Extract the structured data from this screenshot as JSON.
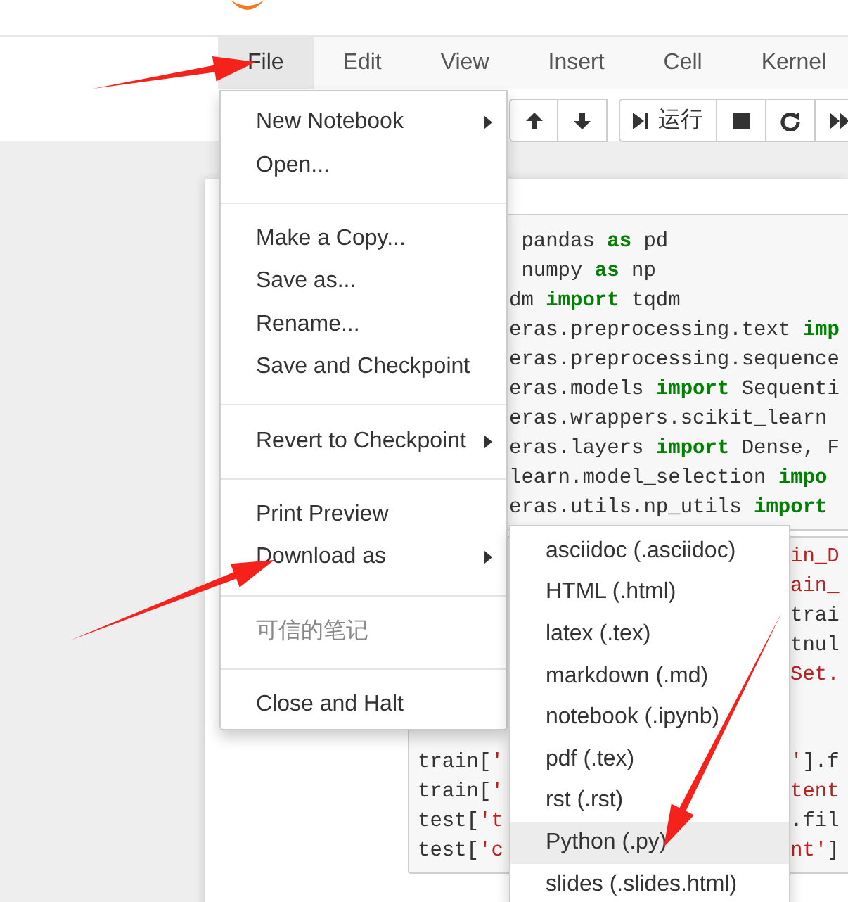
{
  "menubar": [
    {
      "label": "File",
      "selected": true
    },
    {
      "label": "Edit",
      "selected": false
    },
    {
      "label": "View",
      "selected": false
    },
    {
      "label": "Insert",
      "selected": false
    },
    {
      "label": "Cell",
      "selected": false
    },
    {
      "label": "Kernel",
      "selected": false
    }
  ],
  "toolbar": {
    "run_label": "运行"
  },
  "file_menu": [
    {
      "kind": "item",
      "label": "New Notebook",
      "submenu": true,
      "disabled": false
    },
    {
      "kind": "item",
      "label": "Open...",
      "submenu": false,
      "disabled": false
    },
    {
      "kind": "divider"
    },
    {
      "kind": "item",
      "label": "Make a Copy...",
      "submenu": false,
      "disabled": false
    },
    {
      "kind": "item",
      "label": "Save as...",
      "submenu": false,
      "disabled": false
    },
    {
      "kind": "item",
      "label": "Rename...",
      "submenu": false,
      "disabled": false
    },
    {
      "kind": "item",
      "label": "Save and Checkpoint",
      "submenu": false,
      "disabled": false
    },
    {
      "kind": "divider"
    },
    {
      "kind": "item",
      "label": "Revert to Checkpoint",
      "submenu": true,
      "disabled": false
    },
    {
      "kind": "divider"
    },
    {
      "kind": "item",
      "label": "Print Preview",
      "submenu": false,
      "disabled": false
    },
    {
      "kind": "item",
      "label": "Download as",
      "submenu": true,
      "disabled": false
    },
    {
      "kind": "divider"
    },
    {
      "kind": "item",
      "label": "可信的笔记",
      "submenu": false,
      "disabled": true
    },
    {
      "kind": "divider"
    },
    {
      "kind": "item",
      "label": "Close and Halt",
      "submenu": false,
      "disabled": false
    }
  ],
  "download_menu": [
    {
      "label": "asciidoc (.asciidoc)",
      "selected": false
    },
    {
      "label": "HTML (.html)",
      "selected": false
    },
    {
      "label": "latex (.tex)",
      "selected": false
    },
    {
      "label": "markdown (.md)",
      "selected": false
    },
    {
      "label": "notebook (.ipynb)",
      "selected": false
    },
    {
      "label": "pdf (.tex)",
      "selected": false
    },
    {
      "label": "rst (.rst)",
      "selected": false
    },
    {
      "label": "Python (.py)",
      "selected": true
    },
    {
      "label": "slides (.slides.html)",
      "selected": false
    }
  ],
  "cell_1": {
    "lines": [
      [
        {
          "text": " pandas ",
          "kind": "plain"
        },
        {
          "text": "as",
          "kind": "keyword"
        },
        {
          "text": " pd",
          "kind": "plain"
        }
      ],
      [
        {
          "text": " numpy ",
          "kind": "plain"
        },
        {
          "text": "as",
          "kind": "keyword"
        },
        {
          "text": " np",
          "kind": "plain"
        }
      ],
      [
        {
          "text": "dm ",
          "kind": "plain"
        },
        {
          "text": "import",
          "kind": "keyword"
        },
        {
          "text": " tqdm",
          "kind": "plain"
        }
      ],
      [
        {
          "text": "eras.preprocessing.text ",
          "kind": "plain"
        },
        {
          "text": "imp",
          "kind": "keyword"
        }
      ],
      [
        {
          "text": "eras.preprocessing.sequence",
          "kind": "plain"
        }
      ],
      [
        {
          "text": "eras.models ",
          "kind": "plain"
        },
        {
          "text": "import",
          "kind": "keyword"
        },
        {
          "text": " Sequenti",
          "kind": "plain"
        }
      ],
      [
        {
          "text": "eras.wrappers.scikit_learn",
          "kind": "plain"
        }
      ],
      [
        {
          "text": "eras.layers ",
          "kind": "plain"
        },
        {
          "text": "import",
          "kind": "keyword"
        },
        {
          "text": " Dense, F",
          "kind": "plain"
        }
      ],
      [
        {
          "text": "learn.model_selection ",
          "kind": "plain"
        },
        {
          "text": "impo",
          "kind": "keyword"
        }
      ],
      [
        {
          "text": "eras.utils.np_utils ",
          "kind": "plain"
        },
        {
          "text": "import",
          "kind": "keyword"
        }
      ]
    ]
  },
  "cell_2": {
    "upper_lines": [
      [
        {
          "text": "in_D",
          "kind": "string"
        }
      ],
      [
        {
          "text": "ain_",
          "kind": "string"
        }
      ],
      [
        {
          "text": "trai",
          "kind": "plain"
        }
      ],
      [
        {
          "text": "tnul",
          "kind": "plain"
        }
      ],
      [
        {
          "text": "Set.",
          "kind": "string"
        }
      ]
    ],
    "lower_lines": [
      {
        "left": [
          {
            "text": "train[",
            "kind": "plain"
          },
          {
            "text": "'",
            "kind": "string"
          }
        ],
        "right": [
          {
            "text": "'",
            "kind": "string"
          },
          {
            "text": "].f",
            "kind": "plain"
          }
        ]
      },
      {
        "left": [
          {
            "text": "train[",
            "kind": "plain"
          },
          {
            "text": "'",
            "kind": "string"
          }
        ],
        "right": [
          {
            "text": "tent",
            "kind": "string"
          }
        ]
      },
      {
        "left": [
          {
            "text": "test[",
            "kind": "plain"
          },
          {
            "text": "'t",
            "kind": "string"
          }
        ],
        "right": [
          {
            "text": ".fil",
            "kind": "plain"
          }
        ]
      },
      {
        "left": [
          {
            "text": "test[",
            "kind": "plain"
          },
          {
            "text": "'c",
            "kind": "string"
          }
        ],
        "right": [
          {
            "text": "nt'",
            "kind": "string"
          },
          {
            "text": "]",
            "kind": "plain"
          }
        ]
      }
    ]
  }
}
